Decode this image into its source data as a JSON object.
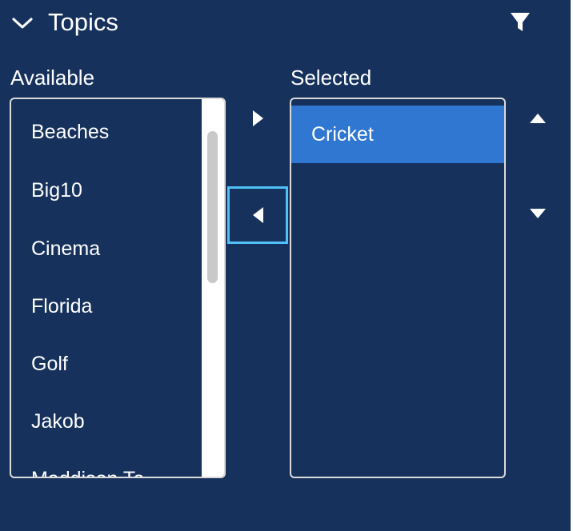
{
  "section": {
    "title": "Topics"
  },
  "available": {
    "label": "Available",
    "items": [
      "Beaches",
      "Big10",
      "Cinema",
      "Florida",
      "Golf",
      "Jakob",
      "Maddison To"
    ]
  },
  "selected": {
    "label": "Selected",
    "items": [
      "Cricket"
    ]
  },
  "icons": {
    "collapse": "chevron-down-icon",
    "filter": "filter-icon",
    "move_right": "triangle-right-icon",
    "move_left": "triangle-left-icon",
    "move_up": "triangle-up-icon",
    "move_down": "triangle-down-icon"
  },
  "colors": {
    "background": "#16325c",
    "selected_option": "#2f77d1",
    "focus_ring": "#4fc1f7",
    "text": "#ffffff"
  }
}
